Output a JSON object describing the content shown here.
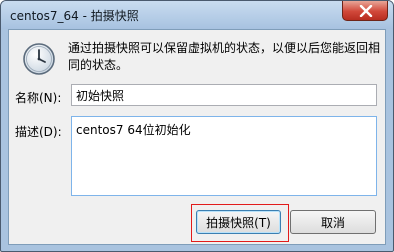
{
  "window": {
    "title": "centos7_64 - 拍摄快照"
  },
  "titlebar": {
    "close_icon": "close-icon"
  },
  "icon": {
    "name": "clock-icon"
  },
  "message": "通过拍摄快照可以保留虚拟机的状态，以便以后您能返回相同的状态。",
  "form": {
    "name_label": "名称(N):",
    "name_value": "初始快照",
    "description_label": "描述(D):",
    "description_value": "centos7 64位初始化"
  },
  "buttons": {
    "snapshot_label": "拍摄快照(T)",
    "cancel_label": "取消"
  },
  "colors": {
    "titlebar": "#a7c2e0",
    "close_button": "#d1483a",
    "focus_highlight": "#e21b1b"
  }
}
